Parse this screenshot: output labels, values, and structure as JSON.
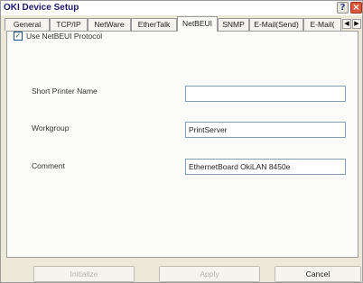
{
  "window": {
    "title": "OKI Device Setup",
    "help_label": "?",
    "close_label": "×"
  },
  "tabs": [
    {
      "label": "General"
    },
    {
      "label": "TCP/IP"
    },
    {
      "label": "NetWare"
    },
    {
      "label": "EtherTalk"
    },
    {
      "label": "NetBEUI",
      "active": true
    },
    {
      "label": "SNMP"
    },
    {
      "label": "E-Mail(Send)"
    },
    {
      "label": "E-Mail("
    }
  ],
  "scroll": {
    "left": "◀",
    "right": "▶"
  },
  "form": {
    "use_protocol": {
      "label": "Use NetBEUI Protocol",
      "checked": true,
      "mark": "✓"
    },
    "short_printer_name": {
      "label": "Short Printer Name",
      "value": ""
    },
    "workgroup": {
      "label": "Workgroup",
      "value": "PrintServer"
    },
    "comment": {
      "label": "Comment",
      "value": "EthernetBoard OkiLAN 8450e"
    }
  },
  "buttons": {
    "initialize": "Initialize",
    "apply": "Apply",
    "cancel": "Cancel"
  }
}
